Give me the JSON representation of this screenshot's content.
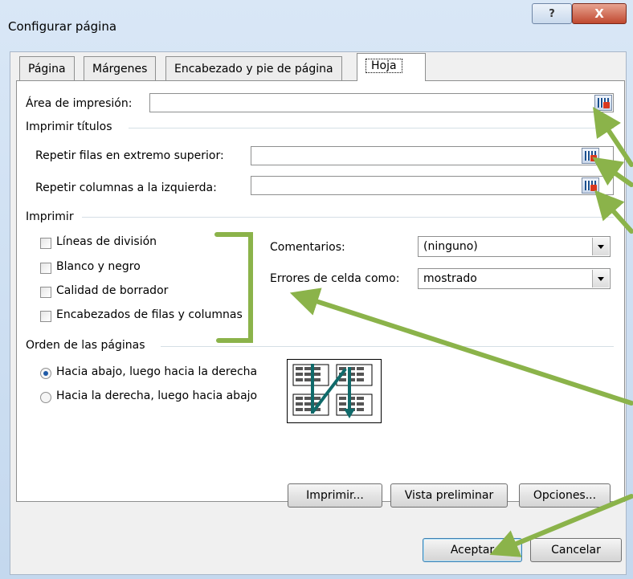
{
  "dialog": {
    "title": "Configurar página",
    "help_label": "?",
    "close_label": "X"
  },
  "tabs": [
    {
      "label": "Página"
    },
    {
      "label": "Márgenes"
    },
    {
      "label": "Encabezado y pie de página"
    },
    {
      "label": "Hoja",
      "active": true
    }
  ],
  "print_area": {
    "label": "Área de impresión:",
    "value": ""
  },
  "print_titles": {
    "section": "Imprimir títulos",
    "rows_label": "Repetir filas en extremo superior:",
    "rows_value": "",
    "cols_label": "Repetir columnas a la izquierda:",
    "cols_value": ""
  },
  "print": {
    "section": "Imprimir",
    "checkboxes": [
      {
        "label": "Líneas de división",
        "checked": false
      },
      {
        "label": "Blanco y negro",
        "checked": false
      },
      {
        "label": "Calidad de borrador",
        "checked": false
      },
      {
        "label": "Encabezados de filas y columnas",
        "checked": false
      }
    ],
    "comments_label": "Comentarios:",
    "comments_value": "(ninguno)",
    "errors_label": "Errores de celda como:",
    "errors_value": "mostrado"
  },
  "page_order": {
    "section": "Orden de las páginas",
    "options": [
      {
        "label": "Hacia abajo, luego hacia la derecha",
        "selected": true
      },
      {
        "label": "Hacia la derecha, luego hacia abajo",
        "selected": false
      }
    ]
  },
  "buttons": {
    "print": "Imprimir...",
    "preview": "Vista preliminar",
    "options": "Opciones...",
    "ok": "Aceptar",
    "cancel": "Cancelar"
  },
  "colors": {
    "annotation": "#8bb34a",
    "accent": "#1f5aa6",
    "order_arrow": "#0f6a6a"
  }
}
